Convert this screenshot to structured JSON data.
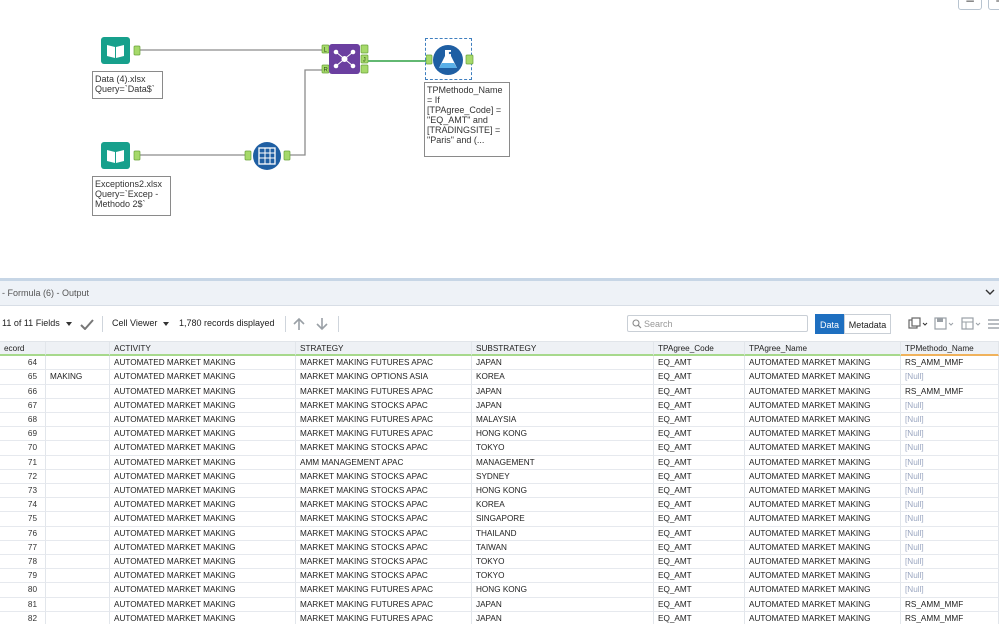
{
  "canvas": {
    "tools": {
      "input1": {
        "annotation": "Data (4).xlsx\nQuery=`Data$`"
      },
      "input2": {
        "annotation": "Exceptions2.xlsx\nQuery=`Excep -\nMethodo 2$`"
      },
      "formula": {
        "annotation": "TPMethodo_Name\n= If\n[TPAgree_Code] =\n\"EQ_AMT\" and\n[TRADINGSITE] =\n\"Paris\"  and (..."
      },
      "join_anchors": {
        "l": "L",
        "r": "R",
        "j": "J"
      }
    },
    "zoom_out_label": "−",
    "zoom_in_label": "+"
  },
  "results": {
    "title": "- Formula (6) - Output",
    "toolbar": {
      "fields_label": "11 of 11 Fields",
      "cell_viewer_label": "Cell Viewer",
      "records_label": "1,780 records displayed",
      "search_placeholder": "Search",
      "data_label": "Data",
      "metadata_label": "Metadata"
    },
    "columns": [
      "ecord",
      "",
      "ACTIVITY",
      "STRATEGY",
      "SUBSTRATEGY",
      "TPAgree_Code",
      "TPAgree_Name",
      "TPMethodo_Name"
    ],
    "rows": [
      [
        "64",
        "",
        "AUTOMATED MARKET MAKING",
        "MARKET MAKING FUTURES APAC",
        "JAPAN",
        "EQ_AMT",
        "AUTOMATED MARKET MAKING",
        "RS_AMM_MMF"
      ],
      [
        "65",
        "MAKING",
        "AUTOMATED MARKET MAKING",
        "MARKET MAKING OPTIONS ASIA",
        "KOREA",
        "EQ_AMT",
        "AUTOMATED MARKET MAKING",
        "[Null]"
      ],
      [
        "66",
        "",
        "AUTOMATED MARKET MAKING",
        "MARKET MAKING FUTURES APAC",
        "JAPAN",
        "EQ_AMT",
        "AUTOMATED MARKET MAKING",
        "RS_AMM_MMF"
      ],
      [
        "67",
        "",
        "AUTOMATED MARKET MAKING",
        "MARKET MAKING STOCKS APAC",
        "JAPAN",
        "EQ_AMT",
        "AUTOMATED MARKET MAKING",
        "[Null]"
      ],
      [
        "68",
        "",
        "AUTOMATED MARKET MAKING",
        "MARKET MAKING FUTURES APAC",
        "MALAYSIA",
        "EQ_AMT",
        "AUTOMATED MARKET MAKING",
        "[Null]"
      ],
      [
        "69",
        "",
        "AUTOMATED MARKET MAKING",
        "MARKET MAKING FUTURES APAC",
        "HONG KONG",
        "EQ_AMT",
        "AUTOMATED MARKET MAKING",
        "[Null]"
      ],
      [
        "70",
        "",
        "AUTOMATED MARKET MAKING",
        "MARKET MAKING STOCKS APAC",
        "TOKYO",
        "EQ_AMT",
        "AUTOMATED MARKET MAKING",
        "[Null]"
      ],
      [
        "71",
        "",
        "AUTOMATED MARKET MAKING",
        "AMM MANAGEMENT APAC",
        "MANAGEMENT",
        "EQ_AMT",
        "AUTOMATED MARKET MAKING",
        "[Null]"
      ],
      [
        "72",
        "",
        "AUTOMATED MARKET MAKING",
        "MARKET MAKING STOCKS APAC",
        "SYDNEY",
        "EQ_AMT",
        "AUTOMATED MARKET MAKING",
        "[Null]"
      ],
      [
        "73",
        "",
        "AUTOMATED MARKET MAKING",
        "MARKET MAKING STOCKS APAC",
        "HONG KONG",
        "EQ_AMT",
        "AUTOMATED MARKET MAKING",
        "[Null]"
      ],
      [
        "74",
        "",
        "AUTOMATED MARKET MAKING",
        "MARKET MAKING STOCKS APAC",
        "KOREA",
        "EQ_AMT",
        "AUTOMATED MARKET MAKING",
        "[Null]"
      ],
      [
        "75",
        "",
        "AUTOMATED MARKET MAKING",
        "MARKET MAKING STOCKS APAC",
        "SINGAPORE",
        "EQ_AMT",
        "AUTOMATED MARKET MAKING",
        "[Null]"
      ],
      [
        "76",
        "",
        "AUTOMATED MARKET MAKING",
        "MARKET MAKING STOCKS APAC",
        "THAILAND",
        "EQ_AMT",
        "AUTOMATED MARKET MAKING",
        "[Null]"
      ],
      [
        "77",
        "",
        "AUTOMATED MARKET MAKING",
        "MARKET MAKING STOCKS APAC",
        "TAIWAN",
        "EQ_AMT",
        "AUTOMATED MARKET MAKING",
        "[Null]"
      ],
      [
        "78",
        "",
        "AUTOMATED MARKET MAKING",
        "MARKET MAKING STOCKS APAC",
        "TOKYO",
        "EQ_AMT",
        "AUTOMATED MARKET MAKING",
        "[Null]"
      ],
      [
        "79",
        "",
        "AUTOMATED MARKET MAKING",
        "MARKET MAKING STOCKS APAC",
        "TOKYO",
        "EQ_AMT",
        "AUTOMATED MARKET MAKING",
        "[Null]"
      ],
      [
        "80",
        "",
        "AUTOMATED MARKET MAKING",
        "MARKET MAKING FUTURES APAC",
        "HONG KONG",
        "EQ_AMT",
        "AUTOMATED MARKET MAKING",
        "[Null]"
      ],
      [
        "81",
        "",
        "AUTOMATED MARKET MAKING",
        "MARKET MAKING FUTURES APAC",
        "JAPAN",
        "EQ_AMT",
        "AUTOMATED MARKET MAKING",
        "RS_AMM_MMF"
      ],
      [
        "82",
        "",
        "AUTOMATED MARKET MAKING",
        "MARKET MAKING FUTURES APAC",
        "JAPAN",
        "EQ_AMT",
        "AUTOMATED MARKET MAKING",
        "RS_AMM_MMF"
      ]
    ]
  },
  "colors": {
    "accent": "#1e6fc0",
    "input_tool": "#17a08c",
    "join_tool": "#6b3fa0",
    "formula_tool": "#1f5fa3",
    "connection": "#2ea043",
    "null_text": "#9aa6c0"
  },
  "icons": [
    "book-input-icon",
    "join-icon",
    "select-records-icon",
    "formula-flask-icon",
    "search-icon",
    "check-icon",
    "arrow-up-icon",
    "arrow-down-icon",
    "copy-icon",
    "save-icon",
    "table-icon",
    "menu-icon",
    "chevron-down-icon"
  ]
}
